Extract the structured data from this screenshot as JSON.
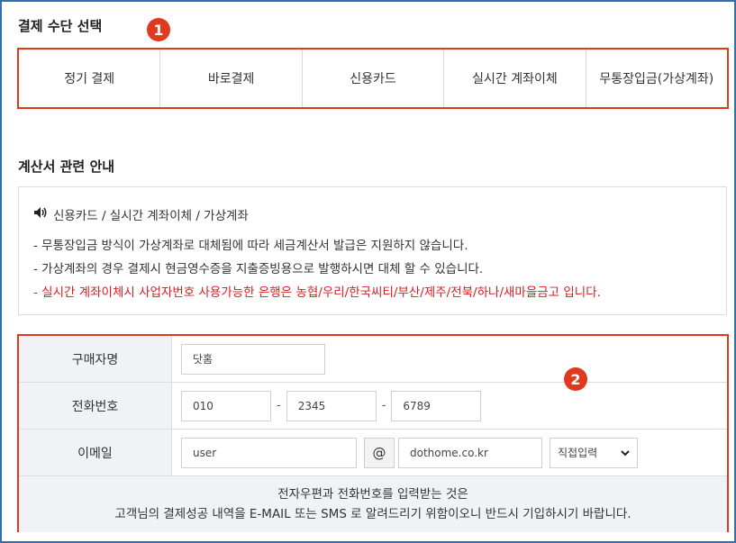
{
  "payment": {
    "title": "결제 수단 선택",
    "badge": "1",
    "tabs": [
      "정기 결제",
      "바로결제",
      "신용카드",
      "실시간 계좌이체",
      "무통장입금(가상계좌)"
    ]
  },
  "notice": {
    "title": "계산서 관련 안내",
    "heading": "신용카드 / 실시간 계좌이체 / 가상계좌",
    "icon": "speaker-icon",
    "lines": [
      "- 무통장입금 방식이 가상계좌로 대체됨에 따라 세금계산서 발급은 지원하지 않습니다.",
      "- 가상계좌의 경우 결제시 현금영수증을 지출증빙용으로 발행하시면 대체 할 수 있습니다."
    ],
    "warning": "- 실시간 계좌이체시 사업자번호 사용가능한 은행은 농협/우리/한국씨티/부산/제주/전북/하나/새마을금고 입니다."
  },
  "form": {
    "badge": "2",
    "buyer_label": "구매자명",
    "buyer_value": "닷홈",
    "phone_label": "전화번호",
    "phone1": "010",
    "phone2": "2345",
    "phone3": "6789",
    "dash": "-",
    "email_label": "이메일",
    "email_user": "user",
    "at": "@",
    "email_domain": "dothome.co.kr",
    "domain_select": "직접입력",
    "footer_line1": "전자우편과 전화번호를 입력받는 것은",
    "footer_line2": "고객님의 결제성공 내역을 E-MAIL 또는 SMS 로 알려드리기 위함이오니 반드시 기입하시기 바랍니다."
  },
  "colors": {
    "accent_red": "#e03a1e",
    "frame_blue": "#2f6fb5",
    "warning_red": "#d81e1e"
  }
}
